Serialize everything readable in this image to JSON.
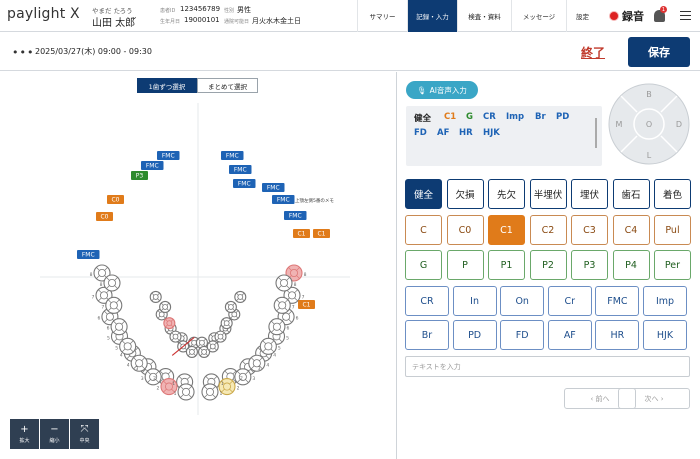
{
  "app": {
    "logo": "paylight X"
  },
  "patient": {
    "kana": "やまだ たろう",
    "name": "山田 太郎",
    "id_key": "患者ID",
    "id": "123456789",
    "dob_key": "生年月日",
    "dob": "19000101",
    "sex_key": "性別",
    "sex": "男性",
    "days_key": "通院可能日",
    "days": "月火水木金土日"
  },
  "nav": [
    "サマリー",
    "記録・入力",
    "検査・資料",
    "メッセージ",
    "設定"
  ],
  "nav_active": 1,
  "recording": {
    "label": "録音"
  },
  "notifications": {
    "count": "1"
  },
  "session": {
    "datetime": "2025/03/27(木) 09:00 - 09:30",
    "end_label": "終了",
    "save_label": "保存"
  },
  "selector": {
    "single": "1歯ずつ選択",
    "batch": "まとめて選択"
  },
  "zoom": {
    "in": "拡大",
    "out": "縮小",
    "center": "中央"
  },
  "chart": {
    "note": "上顎左側5番のメモ",
    "surfaces": {
      "b": "B",
      "m": "M",
      "o": "O",
      "d": "D",
      "l": "L"
    },
    "labels": [
      {
        "t": "FMC",
        "c": "blue"
      },
      {
        "t": "FMC",
        "c": "blue"
      },
      {
        "t": "P3",
        "c": "green"
      },
      {
        "t": "C0",
        "c": "orange"
      },
      {
        "t": "C0",
        "c": "orange"
      },
      {
        "t": "FMC",
        "c": "blue"
      },
      {
        "t": "FMC",
        "c": "blue"
      },
      {
        "t": "FMC",
        "c": "blue"
      },
      {
        "t": "FMC",
        "c": "blue"
      },
      {
        "t": "FMC",
        "c": "blue"
      },
      {
        "t": "FMC",
        "c": "blue"
      },
      {
        "t": "FMC",
        "c": "blue"
      },
      {
        "t": "C1",
        "c": "orange"
      },
      {
        "t": "C1",
        "c": "orange"
      },
      {
        "t": "C1",
        "c": "orange"
      }
    ]
  },
  "ai": {
    "label": "AI音声入力"
  },
  "codes_text": [
    {
      "t": "健全",
      "c": "#222"
    },
    {
      "t": "C1",
      "c": "#e07b1a"
    },
    {
      "t": "G",
      "c": "#2e8b2e"
    },
    {
      "t": "CR",
      "c": "#1e63b5"
    },
    {
      "t": "Imp",
      "c": "#1e63b5"
    },
    {
      "t": "Br",
      "c": "#1e63b5"
    },
    {
      "t": "PD",
      "c": "#1e63b5"
    },
    {
      "t": "FD",
      "c": "#1e63b5"
    },
    {
      "t": "AF",
      "c": "#1e63b5"
    },
    {
      "t": "HR",
      "c": "#1e63b5"
    },
    {
      "t": "HJK",
      "c": "#1e63b5"
    }
  ],
  "status_buttons": [
    "健全",
    "欠損",
    "先欠",
    "半埋伏",
    "埋伏",
    "歯石",
    "着色"
  ],
  "caries_buttons": [
    "C",
    "C0",
    "C1",
    "C2",
    "C3",
    "C4",
    "Pul"
  ],
  "perio_buttons": [
    "G",
    "P",
    "P1",
    "P2",
    "P3",
    "P4",
    "Per"
  ],
  "prosth_row1": [
    "CR",
    "In",
    "On",
    "Cr",
    "FMC",
    "Imp"
  ],
  "prosth_row2": [
    "Br",
    "PD",
    "FD",
    "AF",
    "HR",
    "HJK"
  ],
  "text_input": {
    "placeholder": "テキストを入力"
  },
  "pager": {
    "prev": "前へ",
    "next": "次へ"
  },
  "colors": {
    "navy": "#0d3b73",
    "blue": "#1e63b5",
    "orange": "#e07b1a",
    "green": "#2e8b2e",
    "red": "#c0392b",
    "teal": "#3aa6c6"
  }
}
